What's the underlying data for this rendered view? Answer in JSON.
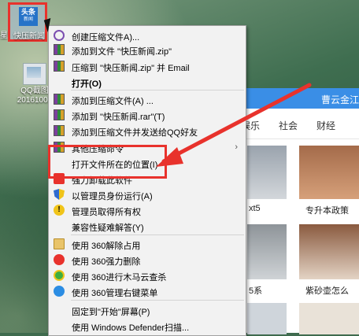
{
  "desktop": {
    "left_edge_text": "星",
    "icons": [
      {
        "name": "toutiao",
        "badge_top": "头条",
        "badge_bottom": "新闻",
        "label": "快压新闻"
      },
      {
        "name": "qq-screenshot",
        "label_line1": "QQ截图",
        "label_line2": "20161001"
      }
    ]
  },
  "browser": {
    "user": "曹云金江",
    "nav": [
      "娱乐",
      "社会",
      "财经"
    ],
    "captions": [
      "xt5",
      "专升本政策",
      "5系",
      "紫砂壶怎么"
    ]
  },
  "context_menu": {
    "items": [
      {
        "label": "创建压缩文件A)...",
        "icon": "rings-icon"
      },
      {
        "label": "添加到文件 \"快压新闻.zip\"",
        "icon": "winrar-icon"
      },
      {
        "label": "压缩到 \"快压新闻.zip\" 并 Email",
        "icon": "winrar-icon"
      },
      {
        "label": "打开(O)",
        "icon": "",
        "bold": true
      },
      {
        "label": "添加到压缩文件(A) ...",
        "icon": "winrar-icon"
      },
      {
        "label": "添加到 \"快压新闻.rar\"(T)",
        "icon": "winrar-icon"
      },
      {
        "label": "添加到压缩文件并发送给QQ好友",
        "icon": "winrar-icon"
      },
      {
        "label": "其他压缩命令",
        "icon": "winrar-icon",
        "submenu": true
      },
      {
        "label": "打开文件所在的位置(I)",
        "icon": ""
      },
      {
        "label": "强力卸载此软件",
        "icon": "uninstall-icon"
      },
      {
        "label": "以管理员身份运行(A)",
        "icon": "shield-icon"
      },
      {
        "label": "管理员取得所有权",
        "icon": "warning-icon"
      },
      {
        "label": "兼容性疑难解答(Y)",
        "icon": ""
      },
      {
        "label": "使用 360解除占用",
        "icon": "folder-icon"
      },
      {
        "label": "使用 360强力删除",
        "icon": "360-delete-icon"
      },
      {
        "label": "使用 360进行木马云查杀",
        "icon": "360-scan-icon"
      },
      {
        "label": "使用 360管理右键菜单",
        "icon": "360-menu-icon"
      },
      {
        "label": "固定到\"开始\"屏幕(P)",
        "icon": ""
      },
      {
        "label": "使用 Windows Defender扫描...",
        "icon": ""
      }
    ],
    "submenu_arrow": "›"
  },
  "annotation_color": "#e8322c"
}
